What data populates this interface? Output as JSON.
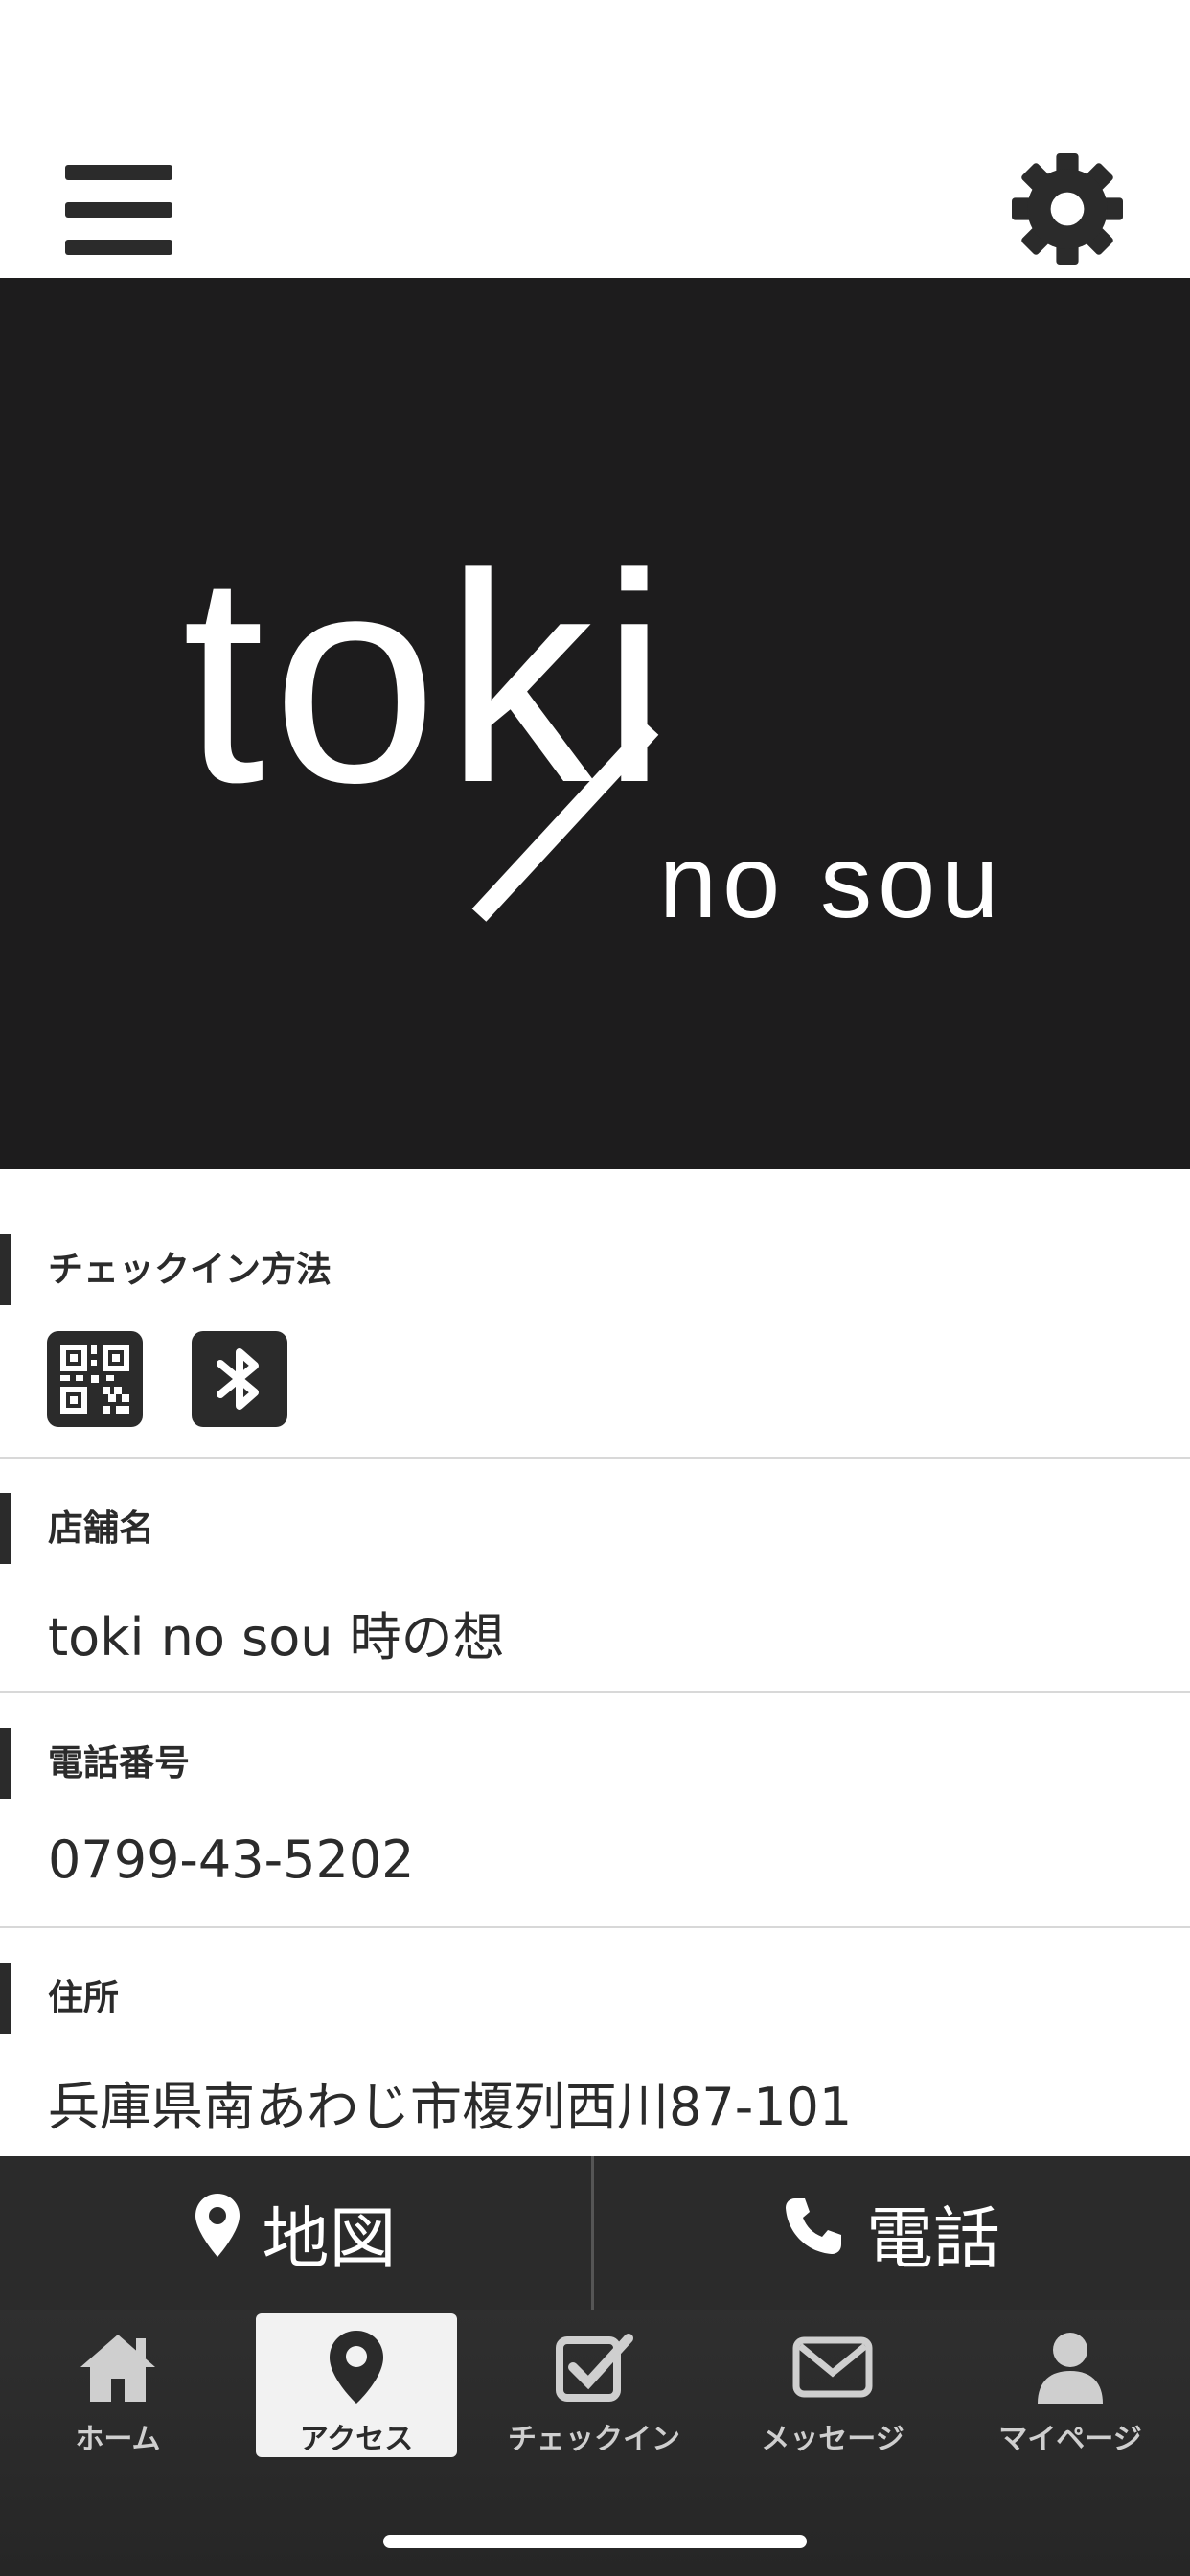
{
  "brand": {
    "logo_main": "toki",
    "logo_sub": "no sou",
    "hero_bg": "#1d1c1d"
  },
  "icons": {
    "menu": "hamburger-menu-icon",
    "settings": "gear-icon",
    "checkin_methods": [
      "qr-code-icon",
      "bluetooth-icon"
    ]
  },
  "sections": {
    "checkin": {
      "title": "チェックイン方法"
    },
    "store": {
      "title": "店舗名",
      "value": "toki no sou 時の想"
    },
    "phone": {
      "title": "電話番号",
      "value": "0799-43-5202"
    },
    "address": {
      "title": "住所",
      "value": "兵庫県南あわじ市榎列西川87-101"
    }
  },
  "actions": {
    "map_label": "地図",
    "call_label": "電話"
  },
  "tabs": [
    {
      "label": "ホーム",
      "icon": "home-icon",
      "active": false
    },
    {
      "label": "アクセス",
      "icon": "map-pin-icon",
      "active": true
    },
    {
      "label": "チェックイン",
      "icon": "checkbox-icon",
      "active": false
    },
    {
      "label": "メッセージ",
      "icon": "envelope-icon",
      "active": false
    },
    {
      "label": "マイページ",
      "icon": "user-icon",
      "active": false
    }
  ],
  "colors": {
    "dark": "#2b2b2b",
    "white": "#ffffff",
    "divider": "#d8d8d8"
  }
}
